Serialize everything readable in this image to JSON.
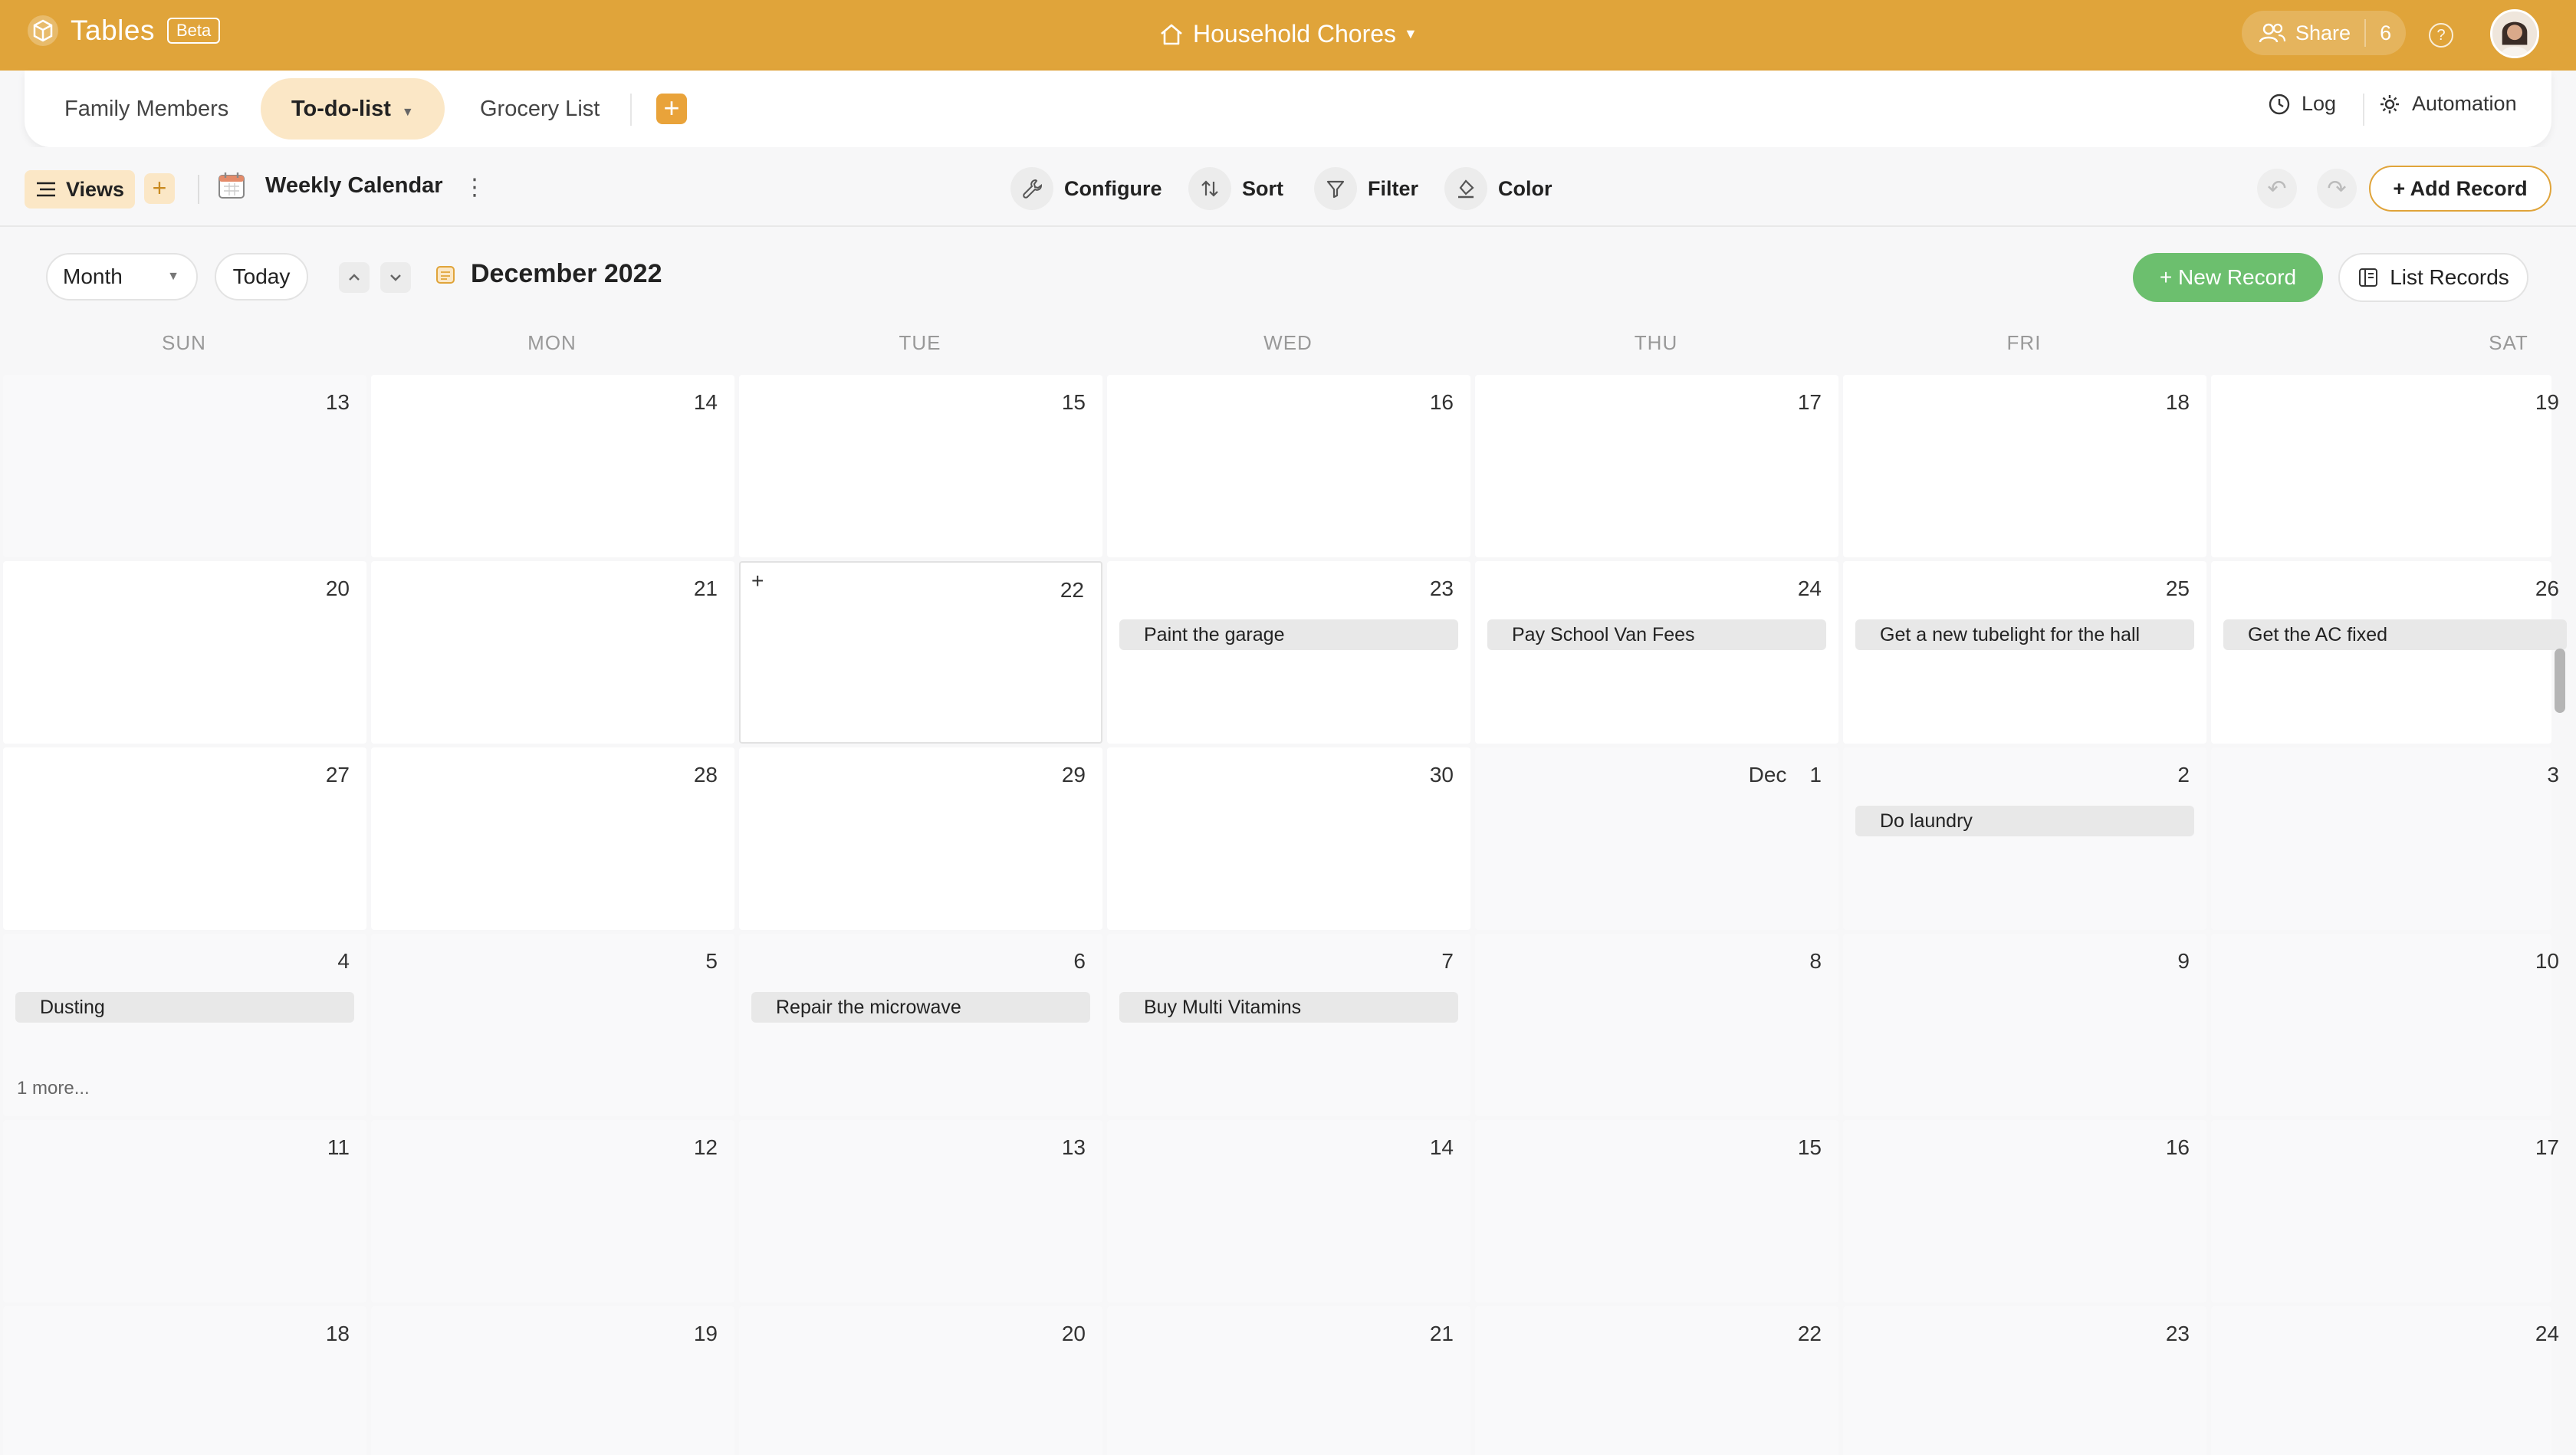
{
  "app": {
    "name": "Tables",
    "badge": "Beta"
  },
  "workspace": {
    "title": "Household Chores"
  },
  "header": {
    "share_label": "Share",
    "share_count": "6",
    "help": "?"
  },
  "tabs": [
    {
      "label": "Family Members"
    },
    {
      "label": "To-do-list",
      "active": true
    },
    {
      "label": "Grocery List"
    }
  ],
  "tab_actions": {
    "add": "+",
    "log": "Log",
    "automation": "Automation"
  },
  "toolbar": {
    "views": "Views",
    "views_add": "+",
    "view_name": "Weekly Calendar",
    "configure": "Configure",
    "sort": "Sort",
    "filter": "Filter",
    "color": "Color",
    "add_record": "+ Add Record"
  },
  "calendar": {
    "mode": "Month",
    "today": "Today",
    "current": "December 2022",
    "new_record": "+  New Record",
    "list_records": "List Records",
    "weekdays": [
      "SUN",
      "MON",
      "TUE",
      "WED",
      "THU",
      "FRI",
      "SAT"
    ],
    "weeks": [
      [
        {
          "day": "13",
          "other": true
        },
        {
          "day": "14",
          "other": false
        },
        {
          "day": "15",
          "other": false
        },
        {
          "day": "16",
          "other": false
        },
        {
          "day": "17",
          "other": false
        },
        {
          "day": "18",
          "other": false
        },
        {
          "day": "19",
          "other": false
        }
      ],
      [
        {
          "day": "20",
          "other": false
        },
        {
          "day": "21",
          "other": false
        },
        {
          "day": "22",
          "other": false,
          "hover": true
        },
        {
          "day": "23",
          "other": false,
          "events": [
            "Paint the garage"
          ]
        },
        {
          "day": "24",
          "other": false,
          "events": [
            "Pay School Van Fees"
          ]
        },
        {
          "day": "25",
          "other": false,
          "events": [
            "Get a new tubelight for the hall"
          ]
        },
        {
          "day": "26",
          "other": false,
          "events": [
            "Get the AC fixed"
          ]
        }
      ],
      [
        {
          "day": "27",
          "other": false
        },
        {
          "day": "28",
          "other": false
        },
        {
          "day": "29",
          "other": false
        },
        {
          "day": "30",
          "other": false
        },
        {
          "day": "1",
          "month": "Dec",
          "other": true
        },
        {
          "day": "2",
          "other": true,
          "events": [
            "Do laundry"
          ]
        },
        {
          "day": "3",
          "other": true
        }
      ],
      [
        {
          "day": "4",
          "other": true,
          "events": [
            "Dusting"
          ],
          "more": "1 more..."
        },
        {
          "day": "5",
          "other": true
        },
        {
          "day": "6",
          "other": true,
          "events": [
            "Repair the microwave"
          ]
        },
        {
          "day": "7",
          "other": true,
          "events": [
            "Buy Multi Vitamins"
          ]
        },
        {
          "day": "8",
          "other": true
        },
        {
          "day": "9",
          "other": true
        },
        {
          "day": "10",
          "other": true
        }
      ],
      [
        {
          "day": "11",
          "other": true
        },
        {
          "day": "12",
          "other": true
        },
        {
          "day": "13",
          "other": true
        },
        {
          "day": "14",
          "other": true
        },
        {
          "day": "15",
          "other": true
        },
        {
          "day": "16",
          "other": true
        },
        {
          "day": "17",
          "other": true
        }
      ],
      [
        {
          "day": "18",
          "other": true
        },
        {
          "day": "19",
          "other": true
        },
        {
          "day": "20",
          "other": true
        },
        {
          "day": "21",
          "other": true
        },
        {
          "day": "22",
          "other": true
        },
        {
          "day": "23",
          "other": true
        },
        {
          "day": "24",
          "other": true
        }
      ]
    ]
  },
  "colors": {
    "brand": "#e0a43a",
    "tab_active": "#fbe7c6",
    "new_record": "#6cbf6e"
  }
}
